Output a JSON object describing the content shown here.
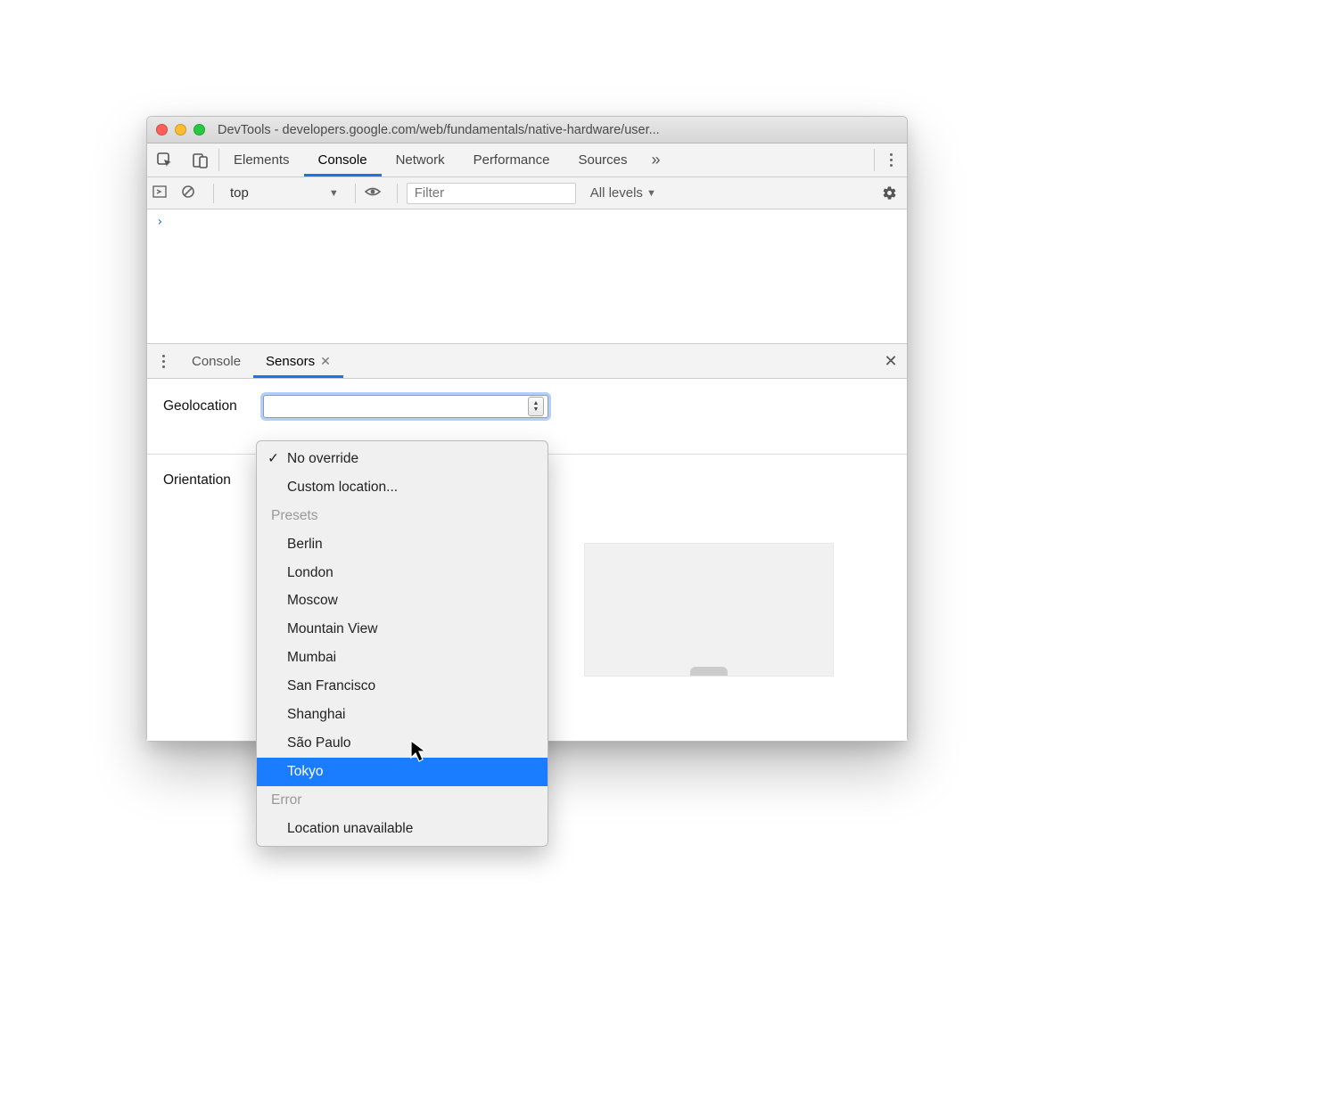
{
  "window": {
    "title": "DevTools - developers.google.com/web/fundamentals/native-hardware/user..."
  },
  "tabs": {
    "items": [
      "Elements",
      "Console",
      "Network",
      "Performance",
      "Sources"
    ],
    "active": "Console",
    "overflow": "»"
  },
  "toolbar": {
    "context": "top",
    "filter_placeholder": "Filter",
    "levels_label": "All levels"
  },
  "console": {
    "prompt": "›"
  },
  "drawer": {
    "tabs": [
      "Console",
      "Sensors"
    ],
    "active": "Sensors"
  },
  "sensors": {
    "geolocation_label": "Geolocation",
    "orientation_label": "Orientation"
  },
  "geolocation_menu": {
    "no_override": "No override",
    "custom": "Custom location...",
    "presets_label": "Presets",
    "presets": [
      "Berlin",
      "London",
      "Moscow",
      "Mountain View",
      "Mumbai",
      "San Francisco",
      "Shanghai",
      "São Paulo",
      "Tokyo"
    ],
    "error_label": "Error",
    "error_item": "Location unavailable",
    "selected": "No override",
    "highlighted": "Tokyo"
  }
}
